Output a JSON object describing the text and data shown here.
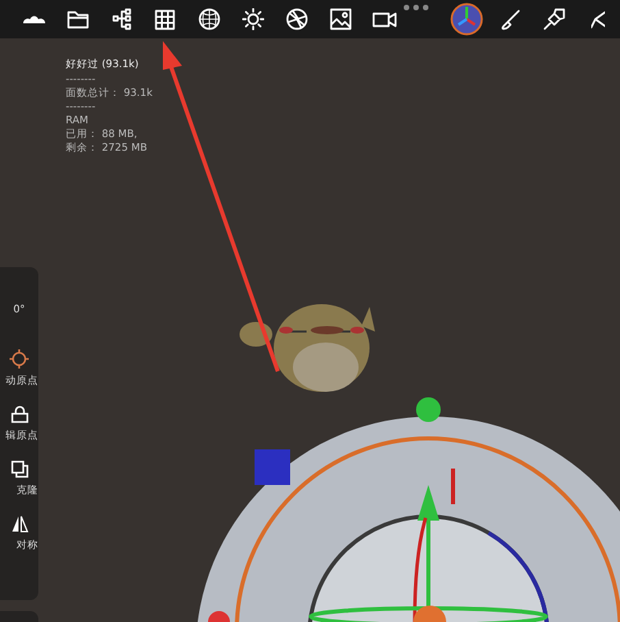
{
  "stats": [
    "好好过 (93.1k)",
    "--------",
    "面数总计： 93.1k",
    "--------",
    "RAM",
    "已用： 88 MB,",
    "剩余： 2725 MB"
  ],
  "side_panel": {
    "angle": "0°",
    "tools": [
      {
        "label": "动原点"
      },
      {
        "label": "辑原点"
      },
      {
        "label": "克隆"
      },
      {
        "label": "对称"
      }
    ]
  }
}
